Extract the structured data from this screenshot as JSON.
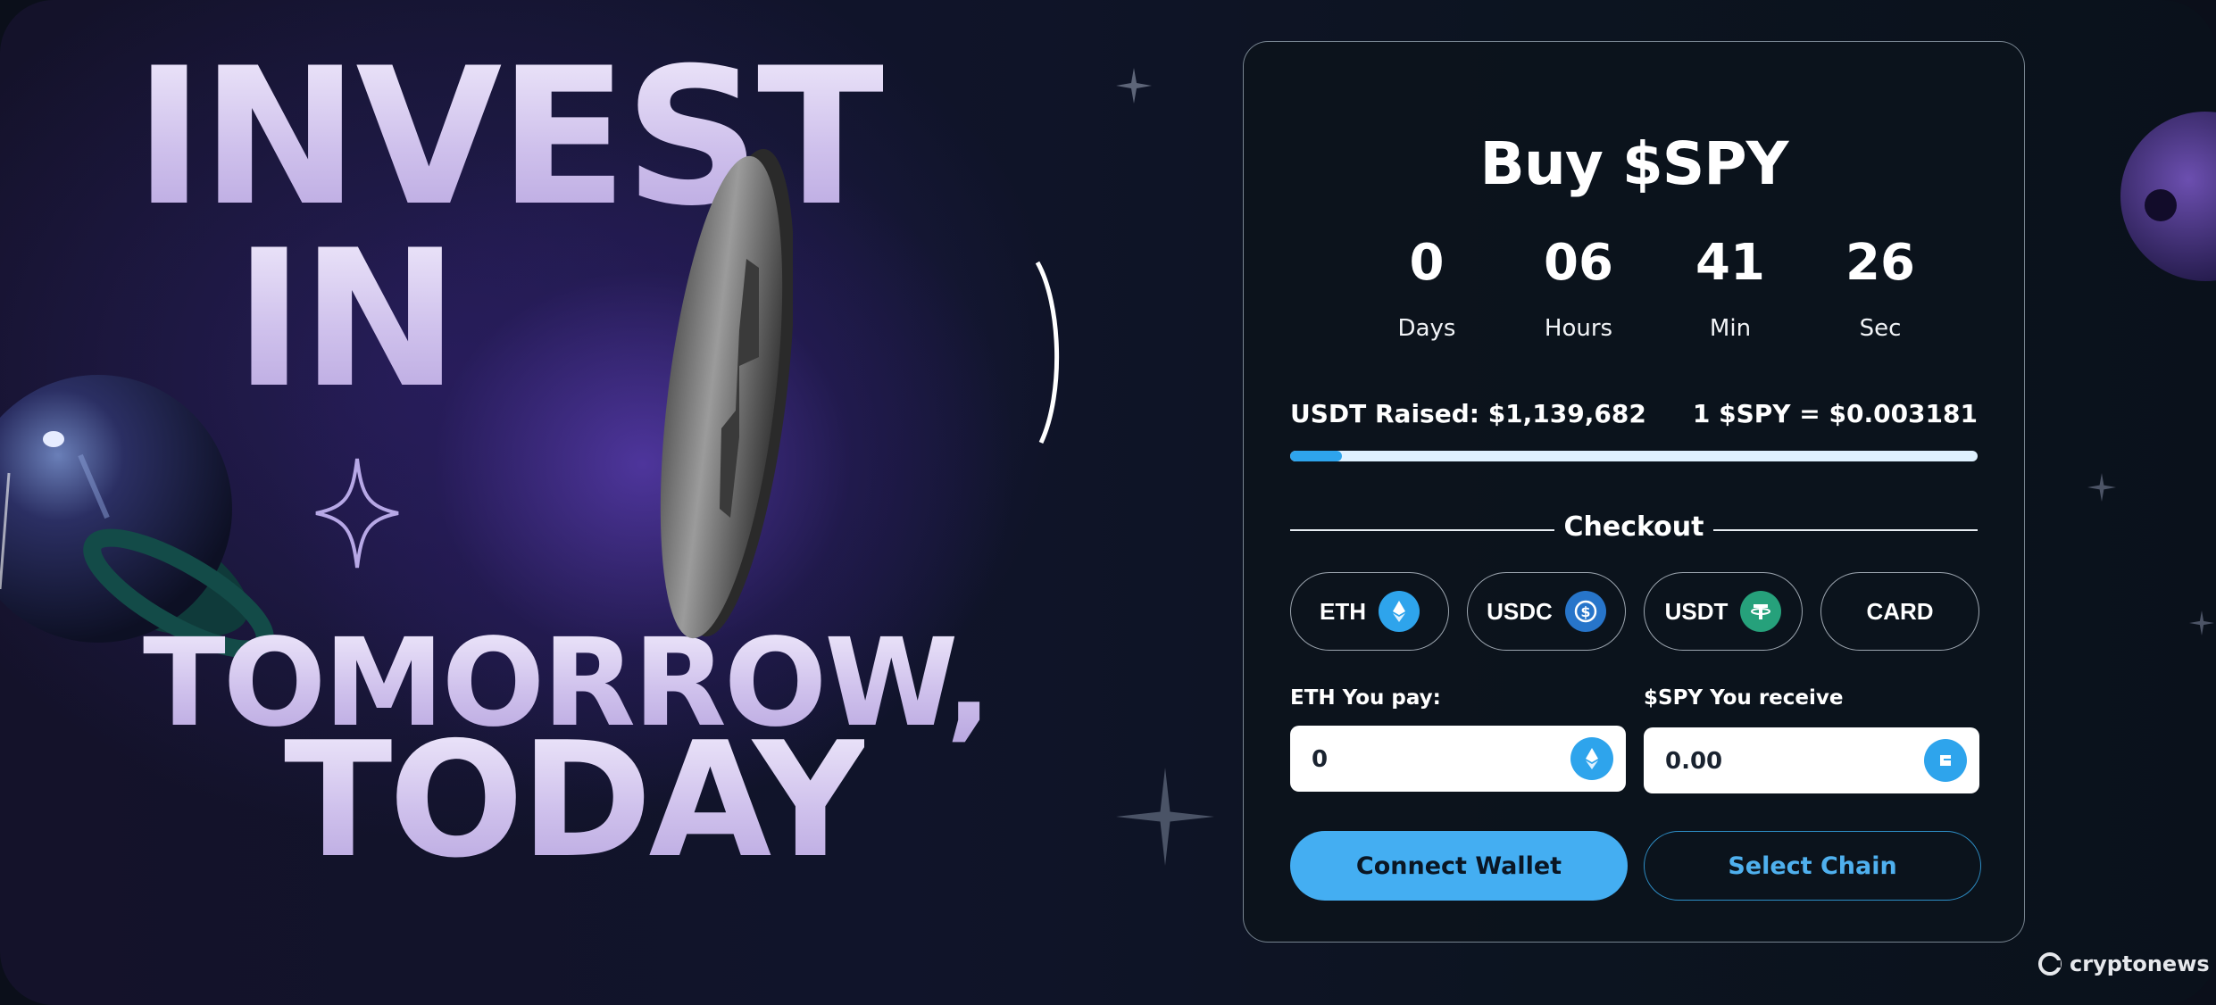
{
  "hero": {
    "line1": "INVEST",
    "line2": "IN",
    "line3": "TOMORROW,",
    "line4": "TODAY"
  },
  "widget": {
    "title": "Buy $SPY",
    "countdown": [
      {
        "value": "0",
        "label": "Days"
      },
      {
        "value": "06",
        "label": "Hours"
      },
      {
        "value": "41",
        "label": "Min"
      },
      {
        "value": "26",
        "label": "Sec"
      }
    ],
    "raised_label": "USDT Raised: $1,139,682",
    "price_label": "1 $SPY = $0.003181",
    "progress_fraction": 0.075,
    "checkout_label": "Checkout",
    "payment_options": [
      {
        "label": "ETH",
        "icon": "ethereum-icon",
        "color": "#2ea4ec"
      },
      {
        "label": "USDC",
        "icon": "usdc-icon",
        "color": "#2775ca"
      },
      {
        "label": "USDT",
        "icon": "tether-icon",
        "color": "#26a17b"
      },
      {
        "label": "CARD",
        "icon": "",
        "color": ""
      }
    ],
    "pay_field": {
      "label": "ETH You pay:",
      "value": "0",
      "icon": "ethereum-icon"
    },
    "receive_field": {
      "label": "$SPY You receive",
      "value": "0.00",
      "icon": "spy-token-icon"
    },
    "connect_button": "Connect Wallet",
    "select_chain_button": "Select Chain"
  },
  "watermark": {
    "text": "cryptonews",
    "icon": "cryptonews-logo-icon"
  },
  "colors": {
    "accent": "#44aef2",
    "progress_track": "#dff1ff",
    "progress_fill": "#2ea4ec",
    "card_bg": "#0c141c"
  }
}
